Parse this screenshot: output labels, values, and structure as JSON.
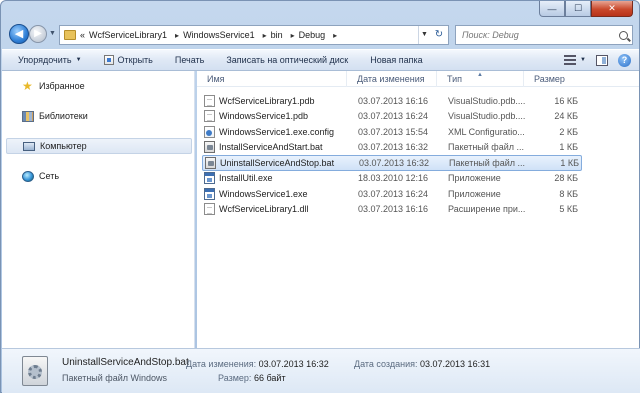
{
  "window": {
    "minimize_glyph": "—",
    "maximize_glyph": "☐",
    "close_glyph": "✕"
  },
  "nav": {
    "back_glyph": "◀",
    "forward_glyph": "▶",
    "dropdown_glyph": "▼"
  },
  "address": {
    "overflow": "«",
    "crumbs": [
      "WcfServiceLibrary1",
      "WindowsService1",
      "bin",
      "Debug"
    ],
    "separator": "▸",
    "refresh_glyph": "↻"
  },
  "search": {
    "placeholder": "Поиск: Debug"
  },
  "toolbar": {
    "organize_label": "Упорядочить",
    "open_label": "Открыть",
    "print_label": "Печать",
    "burn_label": "Записать на оптический диск",
    "new_folder_label": "Новая папка",
    "help_glyph": "?"
  },
  "navpane": {
    "items": [
      {
        "label": "Избранное",
        "icon": "star-icon"
      },
      {
        "label": "Библиотеки",
        "icon": "library-icon"
      },
      {
        "label": "Компьютер",
        "icon": "computer-icon"
      },
      {
        "label": "Сеть",
        "icon": "network-icon"
      }
    ]
  },
  "filelist": {
    "columns": {
      "name": "Имя",
      "date": "Дата изменения",
      "type": "Тип",
      "size": "Размер"
    },
    "sort_glyph": "▲",
    "rows": [
      {
        "name": "WcfServiceLibrary1.pdb",
        "date": "03.07.2013 16:16",
        "type": "VisualStudio.pdb....",
        "size": "16 КБ",
        "icon": "doc"
      },
      {
        "name": "WindowsService1.pdb",
        "date": "03.07.2013 16:24",
        "type": "VisualStudio.pdb....",
        "size": "24 КБ",
        "icon": "doc"
      },
      {
        "name": "WindowsService1.exe.config",
        "date": "03.07.2013 15:54",
        "type": "XML Configuratio...",
        "size": "2 КБ",
        "icon": "cfg"
      },
      {
        "name": "InstallServiceAndStart.bat",
        "date": "03.07.2013 16:32",
        "type": "Пакетный файл ...",
        "size": "1 КБ",
        "icon": "bat"
      },
      {
        "name": "UninstallServiceAndStop.bat",
        "date": "03.07.2013 16:32",
        "type": "Пакетный файл ...",
        "size": "1 КБ",
        "icon": "bat"
      },
      {
        "name": "InstallUtil.exe",
        "date": "18.03.2010 12:16",
        "type": "Приложение",
        "size": "28 КБ",
        "icon": "exe"
      },
      {
        "name": "WindowsService1.exe",
        "date": "03.07.2013 16:24",
        "type": "Приложение",
        "size": "8 КБ",
        "icon": "exe"
      },
      {
        "name": "WcfServiceLibrary1.dll",
        "date": "03.07.2013 16:16",
        "type": "Расширение при...",
        "size": "5 КБ",
        "icon": "doc"
      }
    ]
  },
  "details": {
    "filename": "UninstallServiceAndStop.bat",
    "filetype": "Пакетный файл Windows",
    "modified_label": "Дата изменения:",
    "modified_value": "03.07.2013 16:32",
    "created_label": "Дата создания:",
    "created_value": "03.07.2013 16:31",
    "size_label": "Размер:",
    "size_value": "66 байт"
  }
}
